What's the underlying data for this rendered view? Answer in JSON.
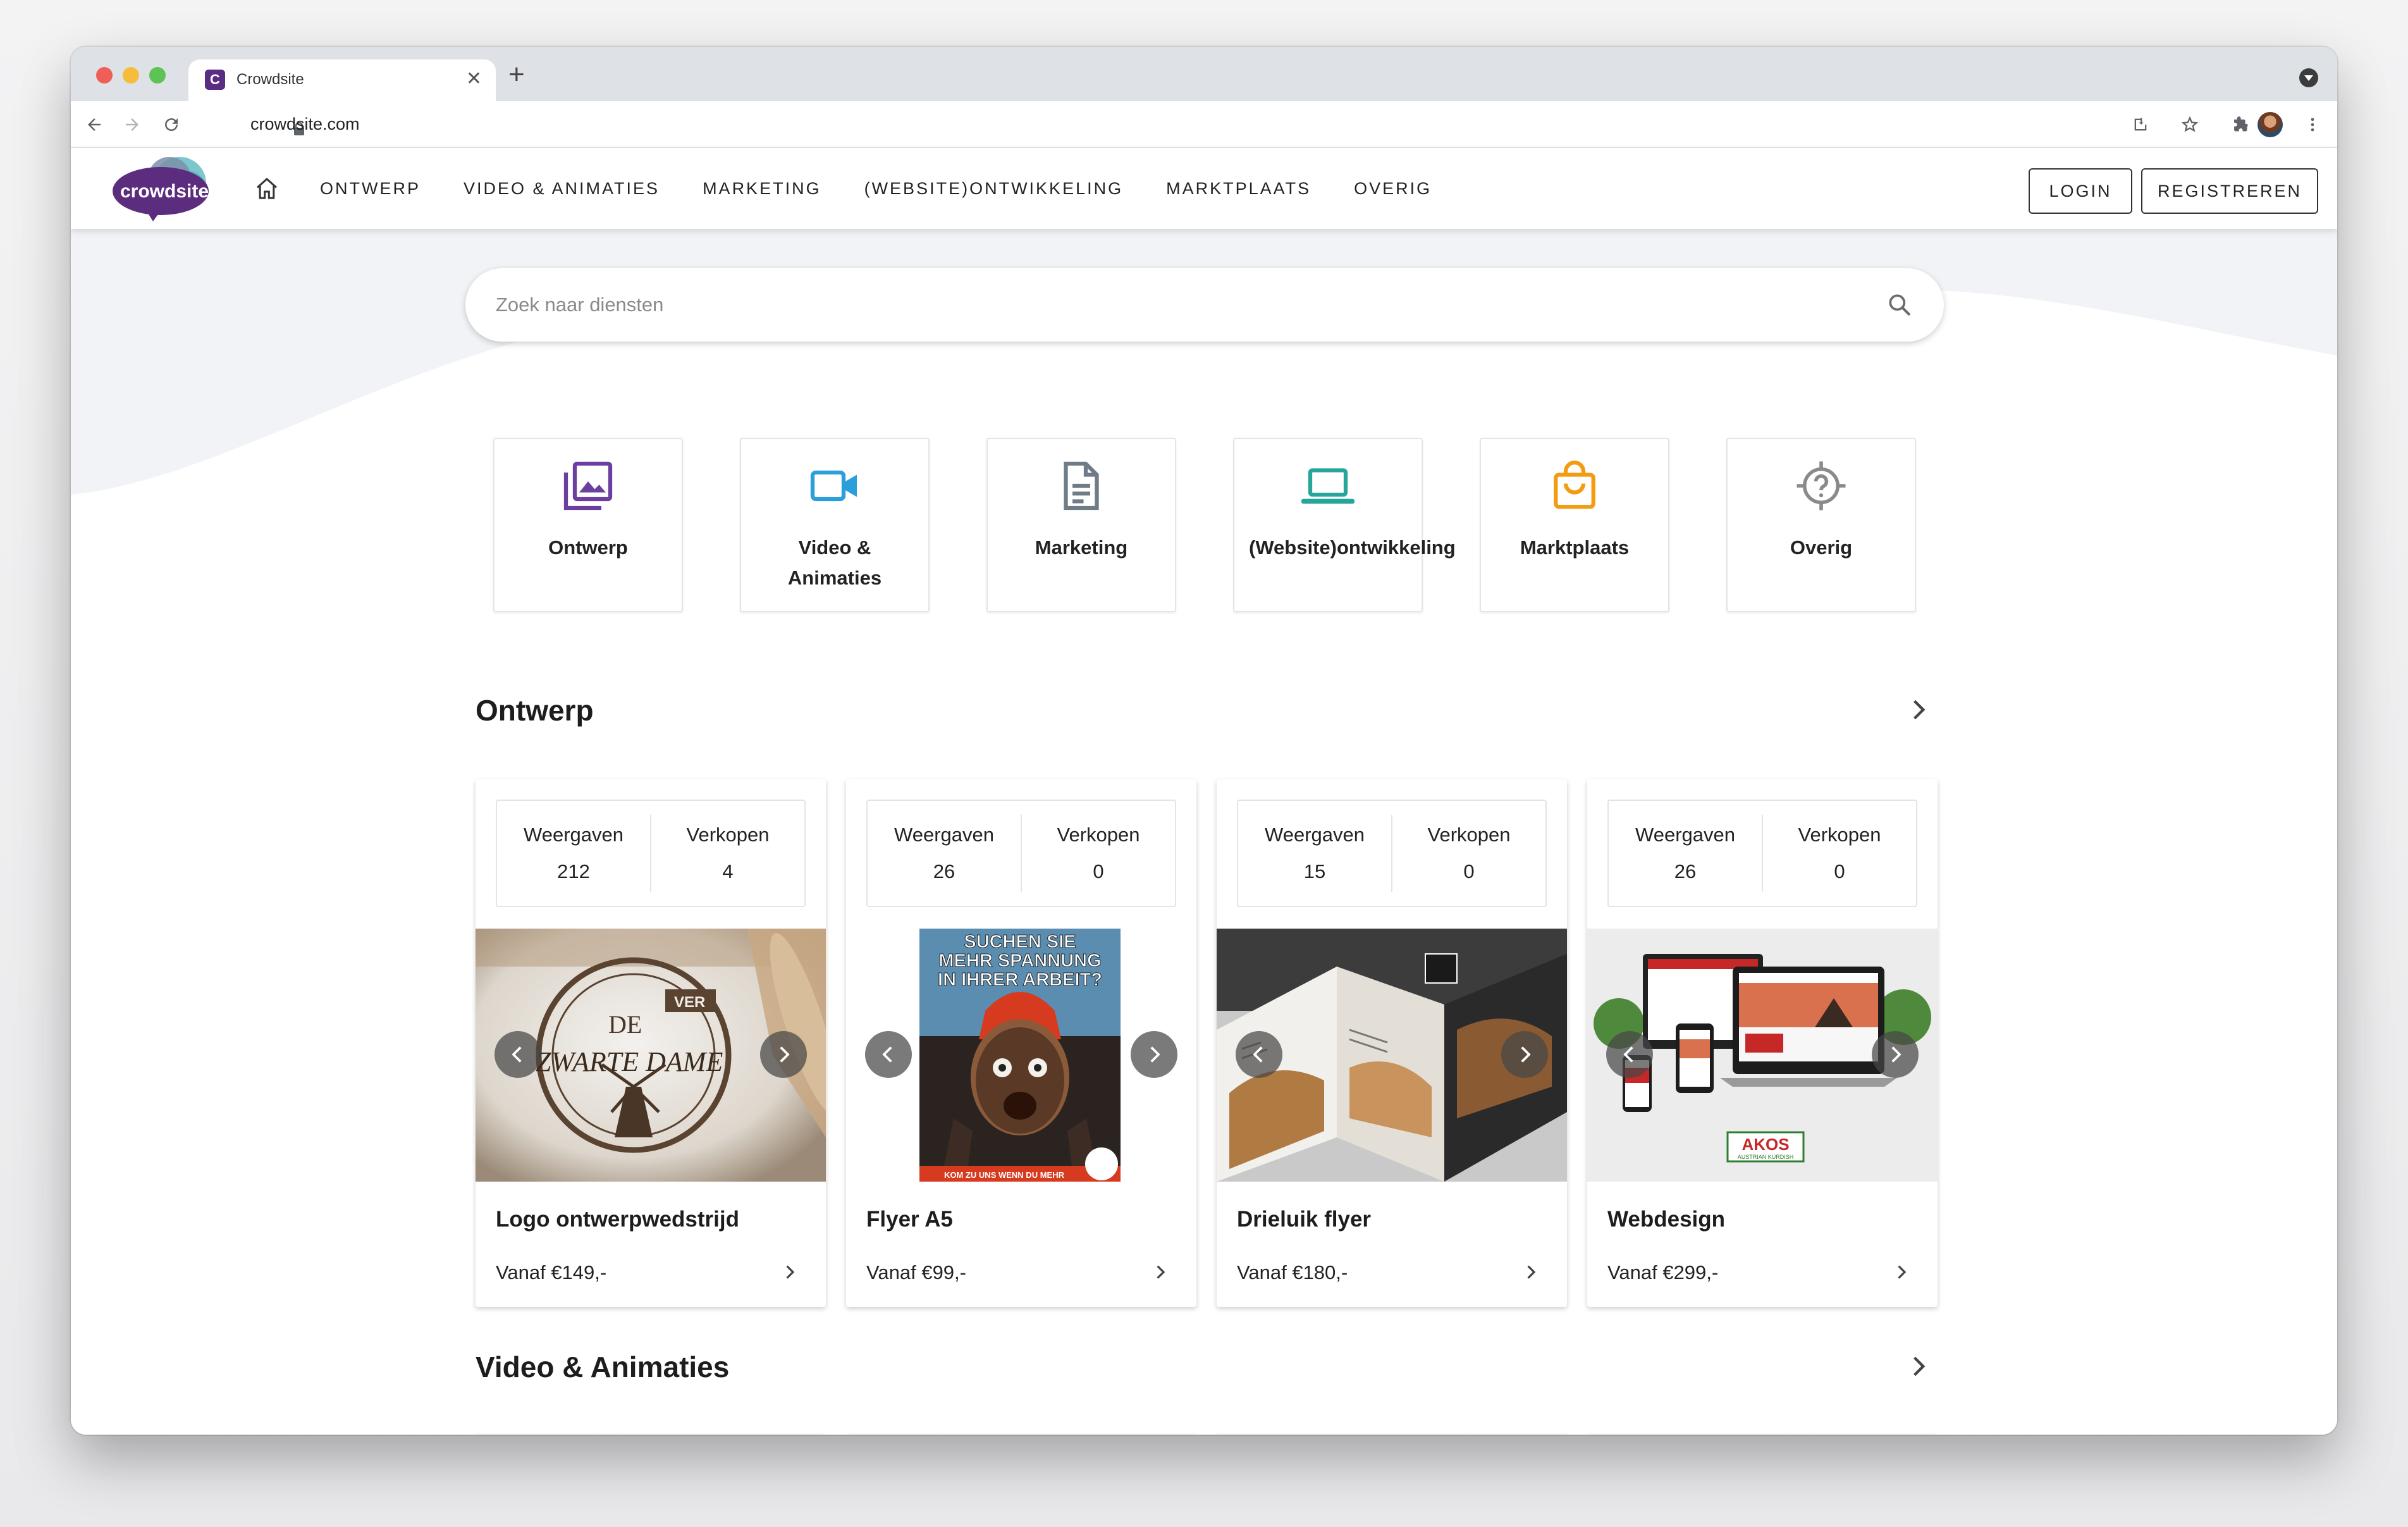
{
  "browser": {
    "tab_title": "Crowdsite",
    "tab_favicon_letter": "C",
    "url": "crowdsite.com"
  },
  "header": {
    "logo_text": "crowdsite",
    "nav": [
      "ONTWERP",
      "VIDEO & ANIMATIES",
      "MARKETING",
      "(WEBSITE)ONTWIKKELING",
      "MARKTPLAATS",
      "OVERIG"
    ],
    "login_label": "LOGIN",
    "register_label": "REGISTREREN"
  },
  "search": {
    "placeholder": "Zoek naar diensten"
  },
  "categories": [
    {
      "label": "Ontwerp",
      "icon": "image-gallery-icon",
      "color": "#6b3fa0"
    },
    {
      "label": "Video & Animaties",
      "icon": "video-camera-icon",
      "color": "#2b9fd9"
    },
    {
      "label": "Marketing",
      "icon": "document-icon",
      "color": "#6f7b86"
    },
    {
      "label": "(Website)ontwikkeling",
      "icon": "laptop-icon",
      "color": "#26a69a"
    },
    {
      "label": "Marktplaats",
      "icon": "shopping-bag-icon",
      "color": "#f39c12"
    },
    {
      "label": "Overig",
      "icon": "help-target-icon",
      "color": "#8a8a8a"
    }
  ],
  "sections": [
    {
      "title": "Ontwerp",
      "cards": [
        {
          "views_label": "Weergaven",
          "views": "212",
          "sales_label": "Verkopen",
          "sales": "4",
          "title": "Logo ontwerpwedstrijd",
          "price": "Vanaf €149,-",
          "image_text": [
            "DE",
            "ZWARTE DAME",
            "VER"
          ]
        },
        {
          "views_label": "Weergaven",
          "views": "26",
          "sales_label": "Verkopen",
          "sales": "0",
          "title": "Flyer A5",
          "price": "Vanaf €99,-",
          "image_text": [
            "SUCHEN SIE",
            "MEHR SPANNUNG",
            "IN IHRER ARBEIT?",
            "KOM ZU UNS WENN DU MEHR"
          ]
        },
        {
          "views_label": "Weergaven",
          "views": "15",
          "sales_label": "Verkopen",
          "sales": "0",
          "title": "Drieluik flyer",
          "price": "Vanaf €180,-",
          "image_text": []
        },
        {
          "views_label": "Weergaven",
          "views": "26",
          "sales_label": "Verkopen",
          "sales": "0",
          "title": "Webdesign",
          "price": "Vanaf €299,-",
          "image_text": [
            "AKOS",
            "AUSTRIAN KURDISH"
          ]
        }
      ]
    },
    {
      "title": "Video & Animaties",
      "cards": []
    }
  ]
}
